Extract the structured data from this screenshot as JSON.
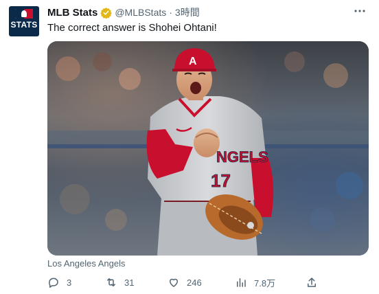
{
  "account": {
    "name": "MLB Stats",
    "handle": "@MLBStats",
    "separator": "·",
    "time": "3時間",
    "verified_color": "#e2b719",
    "avatar_label": "STATS"
  },
  "tweet": {
    "text": "The correct answer is Shohei Ohtani!",
    "image_caption": "Los Angeles Angels",
    "jersey_text": "NGELS",
    "jersey_number": "17"
  },
  "actions": {
    "replies": "3",
    "retweets": "31",
    "likes": "246",
    "views": "7.8万"
  },
  "icons": [
    "more-icon",
    "verified-badge-icon",
    "reply-icon",
    "retweet-icon",
    "like-icon",
    "views-icon",
    "share-icon"
  ],
  "colors": {
    "text": "#0f1419",
    "secondary": "#536471",
    "angels_red": "#c8102e"
  }
}
